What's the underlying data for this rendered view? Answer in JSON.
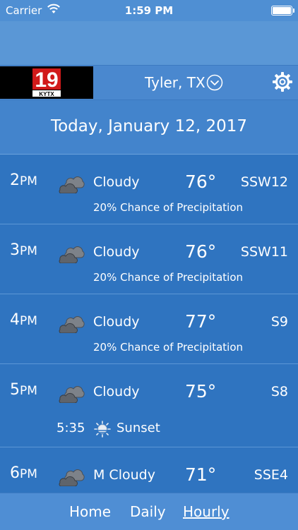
{
  "status_bar": {
    "carrier": "Carrier",
    "time": "1:59 PM"
  },
  "header": {
    "logo_number": "19",
    "logo_callsign": "KYTX",
    "location": "Tyler, TX"
  },
  "date_label": "Today, January 12, 2017",
  "hours": [
    {
      "hour": "2",
      "ampm": "PM",
      "condition": "Cloudy",
      "temp": "76°",
      "wind": "SSW12",
      "precip": "20% Chance of Precipitation"
    },
    {
      "hour": "3",
      "ampm": "PM",
      "condition": "Cloudy",
      "temp": "76°",
      "wind": "SSW11",
      "precip": "20% Chance of Precipitation"
    },
    {
      "hour": "4",
      "ampm": "PM",
      "condition": "Cloudy",
      "temp": "77°",
      "wind": "S9",
      "precip": "20% Chance of Precipitation"
    },
    {
      "hour": "5",
      "ampm": "PM",
      "condition": "Cloudy",
      "temp": "75°",
      "wind": "S8",
      "sun_time": "5:35",
      "sun_event": "Sunset"
    },
    {
      "hour": "6",
      "ampm": "PM",
      "condition": "M Cloudy",
      "temp": "71°",
      "wind": "SSE4"
    }
  ],
  "tabs": {
    "home": "Home",
    "daily": "Daily",
    "hourly": "Hourly"
  },
  "colors": {
    "primary": "#2f74c0",
    "header": "#4a88cf",
    "logo_red": "#d11a1a"
  }
}
